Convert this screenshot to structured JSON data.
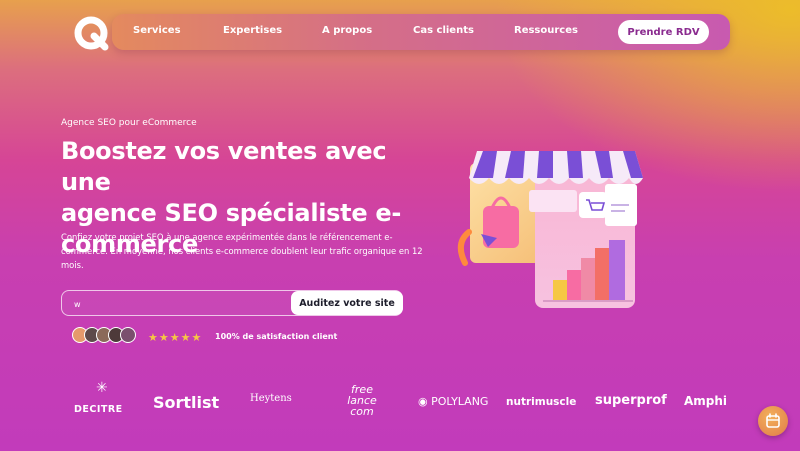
{
  "nav": {
    "items": [
      "Services",
      "Expertises",
      "A propos",
      "Cas clients",
      "Ressources"
    ],
    "cta_label": "Prendre RDV"
  },
  "hero": {
    "eyebrow": "Agence SEO pour eCommerce",
    "headline_1": "Boostez vos ventes avec une",
    "headline_2": "agence SEO spécialiste e-",
    "headline_3": "commerce",
    "description": "Confiez votre projet SEO à une agence expérimentée dans le référencement e-commerce. En moyenne, nos clients e-commerce doublent leur trafic organique en 12 mois.",
    "input_value": "w",
    "button_label": "Auditez votre site",
    "stars": "★★★★★",
    "satisfaction": "100% de satisfaction client"
  },
  "clients": [
    "DECITRE",
    "Sortlist",
    "Heytens",
    "free lance com",
    "POLYLANG",
    "nutrimuscle",
    "superprof",
    "Amphi"
  ],
  "colors": {
    "accent": "#c23bbb",
    "brand_purple": "#8a2b8f",
    "star": "#f6c744"
  }
}
